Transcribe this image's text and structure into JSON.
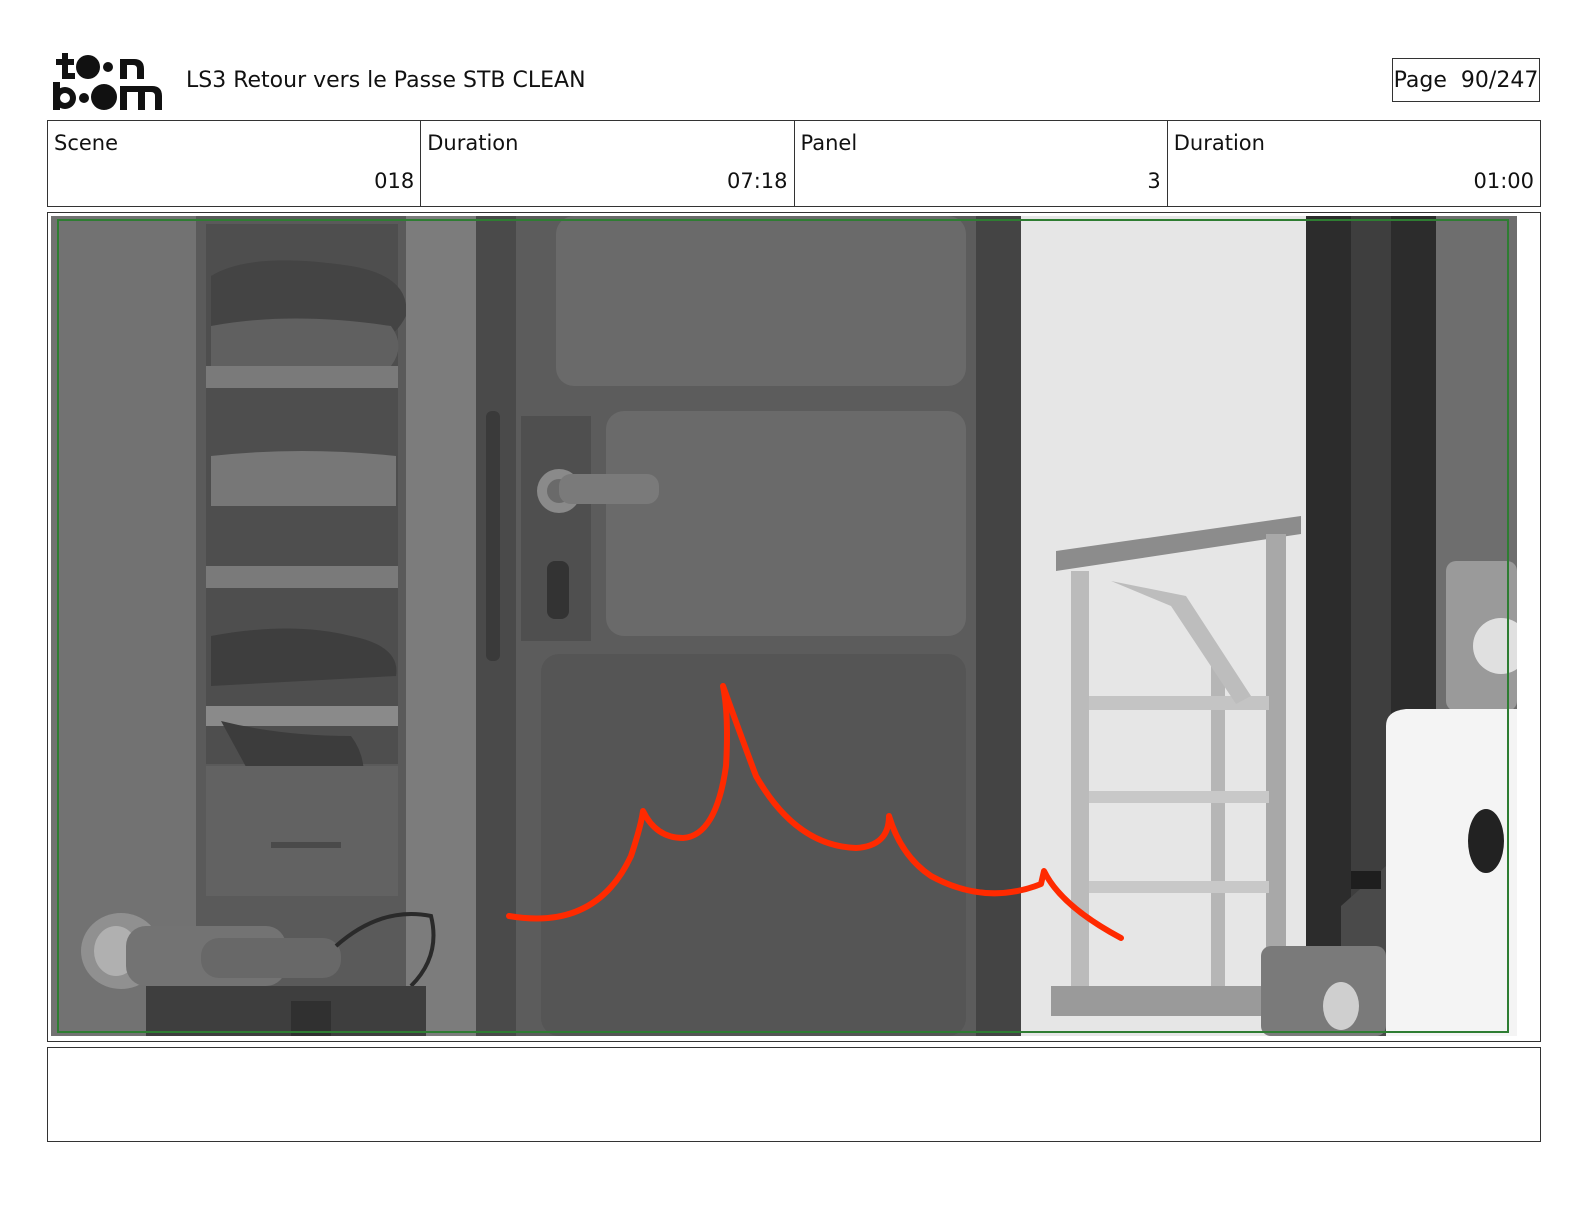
{
  "header": {
    "logo_text": "toonboom",
    "project_title": "LS3 Retour vers le Passe STB CLEAN",
    "page_label": "Page",
    "page_value": "90/247"
  },
  "info": [
    {
      "label": "Scene",
      "value": "018"
    },
    {
      "label": "Duration",
      "value": "07:18"
    },
    {
      "label": "Panel",
      "value": "3"
    },
    {
      "label": "Duration",
      "value": "01:00"
    }
  ],
  "panel": {
    "image_icon": "storyboard-frame-image",
    "annotation_color": "#ff2a00",
    "safe_frame_color": "#2e7d32"
  },
  "notes": {
    "text": ""
  }
}
